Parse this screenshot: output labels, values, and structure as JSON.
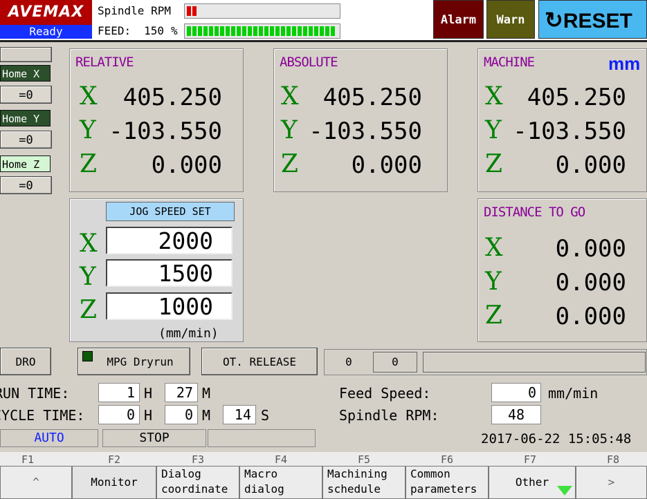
{
  "header": {
    "logo_text": "AVEMAX",
    "status": "Ready",
    "spindle_label": "Spindle RPM",
    "feed_label": "FEED:",
    "feed_value": "150",
    "feed_unit": "%",
    "spindle_bar_level": 0.08,
    "feed_bar_level": 1.0,
    "alarm_label": "Alarm",
    "warn_label": "Warn",
    "reset_label": "RESET"
  },
  "home": {
    "x_label": "Home X",
    "x_zero": "=0",
    "y_label": "Home Y",
    "y_zero": "=0",
    "z_label": "Home Z",
    "z_zero": "=0"
  },
  "relative": {
    "title": "RELATIVE",
    "x": "405.250",
    "y": "-103.550",
    "z": "0.000"
  },
  "absolute": {
    "title": "ABSOLUTE",
    "x": "405.250",
    "y": "-103.550",
    "z": "0.000"
  },
  "machine": {
    "title": "MACHINE",
    "unit": "mm",
    "x": "405.250",
    "y": "-103.550",
    "z": "0.000"
  },
  "axes": {
    "x": "X",
    "y": "Y",
    "z": "Z"
  },
  "jog": {
    "title": "JOG SPEED SET",
    "x": "2000",
    "y": "1500",
    "z": "1000",
    "unit": "(mm/min)"
  },
  "distance": {
    "title": "DISTANCE TO GO",
    "x": "0.000",
    "y": "0.000",
    "z": "0.000"
  },
  "controls": {
    "dro": "DRO",
    "mpg": "MPG Dryrun",
    "ot_release": "OT. RELEASE",
    "counter_a": "0",
    "counter_b": "0"
  },
  "times": {
    "run_label": "RUN TIME:",
    "cycle_label": "CYCLE TIME:",
    "run_h": "1",
    "run_m": "27",
    "cycle_h": "0",
    "cycle_m": "0",
    "cycle_s": "14",
    "h": "H",
    "m": "M",
    "s": "S",
    "feed_speed_label": "Feed Speed:",
    "feed_speed": "0",
    "feed_speed_unit": "mm/min",
    "spindle_rpm_label": "Spindle RPM:",
    "spindle_rpm": "48"
  },
  "status_bar": {
    "mode": "AUTO",
    "state": "STOP",
    "datetime": "2017-06-22 15:05:48"
  },
  "fkeys": {
    "f1": "F1",
    "f2": "F2",
    "f3": "F3",
    "f4": "F4",
    "f5": "F5",
    "f6": "F6",
    "f7": "F7",
    "f8": "F8",
    "b1": "^",
    "b2": "Monitor",
    "b3a": "Dialog",
    "b3b": "coordinate",
    "b4a": "Macro",
    "b4b": "dialog",
    "b5a": "Machining",
    "b5b": "schedule",
    "b6a": "Common",
    "b6b": "parameters",
    "b7": "Other",
    "b8": ">"
  },
  "colors": {
    "logo": "#b00000",
    "ready": "#1530ff",
    "panel_title": "#8c0098",
    "axis": "#008000",
    "bar_green": "#00d000",
    "bar_red": "#e00000"
  }
}
